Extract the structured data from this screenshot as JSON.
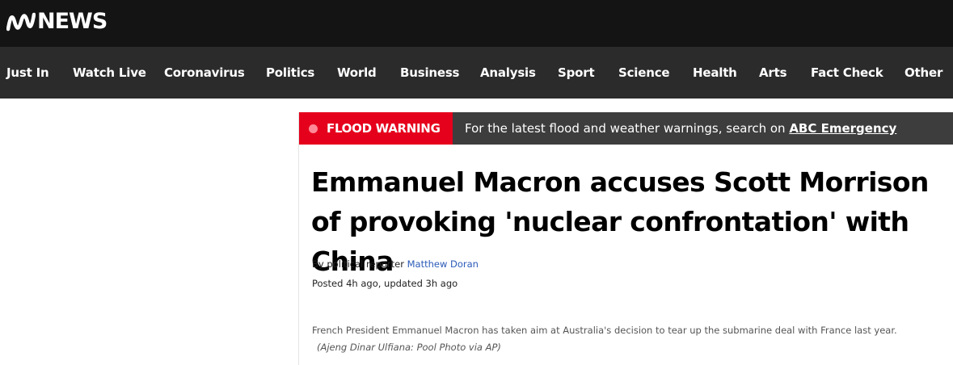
{
  "brand": {
    "logo_text": "NEWS"
  },
  "nav": {
    "items": [
      {
        "label": "Just In"
      },
      {
        "label": "Watch Live"
      },
      {
        "label": "Coronavirus"
      },
      {
        "label": "Politics"
      },
      {
        "label": "World"
      },
      {
        "label": "Business"
      },
      {
        "label": "Analysis"
      },
      {
        "label": "Sport"
      },
      {
        "label": "Science"
      },
      {
        "label": "Health"
      },
      {
        "label": "Arts"
      },
      {
        "label": "Fact Check"
      },
      {
        "label": "Other"
      }
    ]
  },
  "alert": {
    "label": "FLOOD WARNING",
    "message": "For the latest flood and weather warnings, search on ",
    "link_text": "ABC Emergency",
    "accent_color": "#e5001c"
  },
  "article": {
    "headline": "Emmanuel Macron accuses Scott Morrison of provoking 'nuclear confrontation' with China",
    "byline_prefix": "By political reporter ",
    "author": "Matthew Doran",
    "posted": "Posted 4h ago, updated 3h ago",
    "caption": "French President Emmanuel Macron has taken aim at Australia's decision to tear up the submarine deal with France last year.",
    "credit": "(Ajeng Dinar Ulfiana: Pool Photo via AP)"
  }
}
